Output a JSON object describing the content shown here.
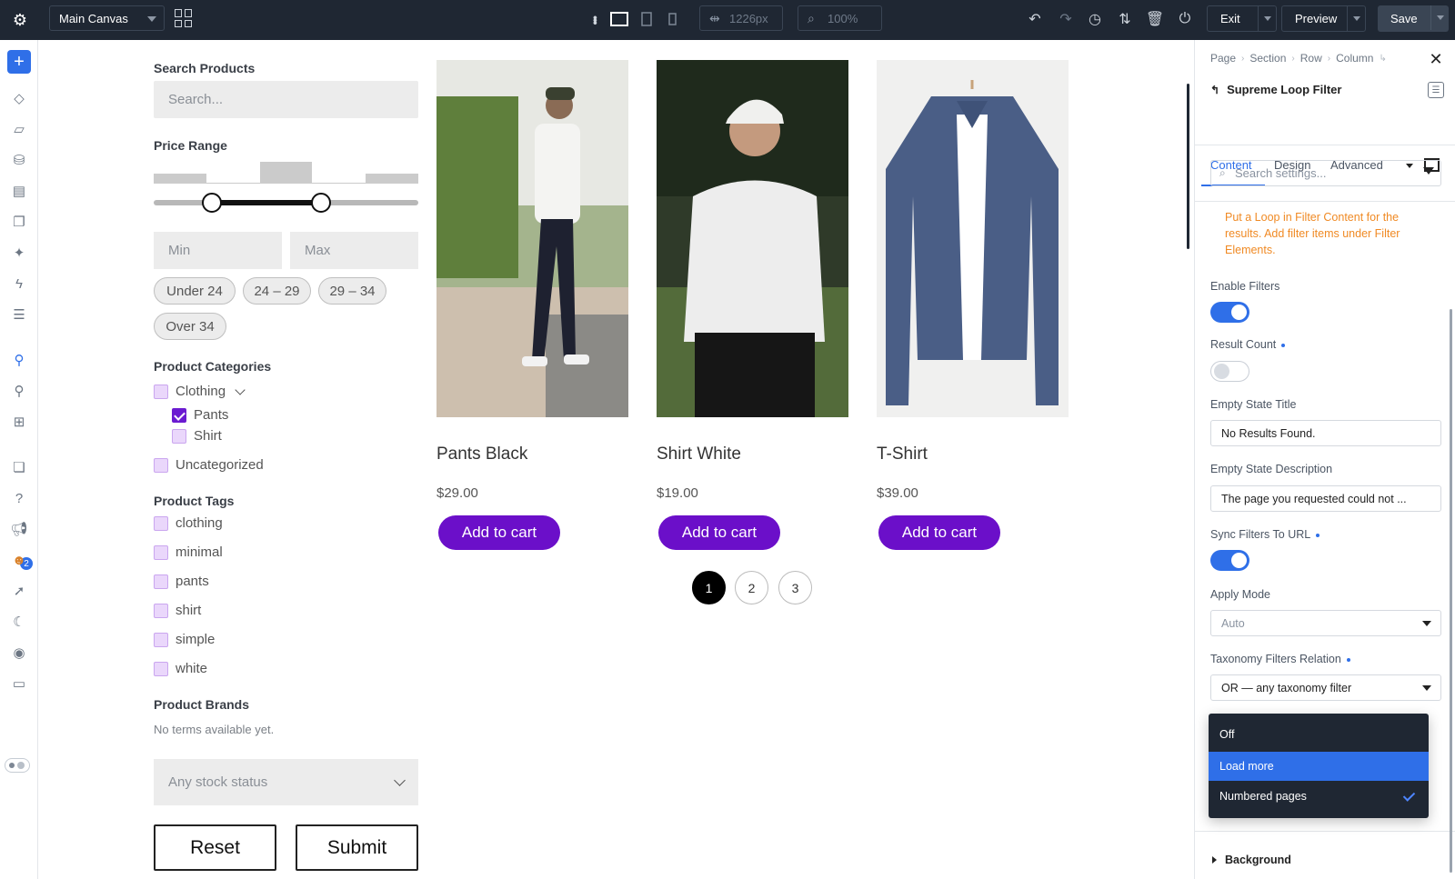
{
  "topbar": {
    "canvas_select": "Main Canvas",
    "width_value": "1226px",
    "zoom_value": "100%",
    "exit_label": "Exit",
    "preview_label": "Preview",
    "save_label": "Save"
  },
  "leftbar": {
    "add_icon": "+",
    "notification_count": "2"
  },
  "filters": {
    "search_heading": "Search Products",
    "search_placeholder": "Search...",
    "price_heading": "Price Range",
    "min_placeholder": "Min",
    "max_placeholder": "Max",
    "price_chips": [
      "Under 24",
      "24 – 29",
      "29 – 34",
      "Over 34"
    ],
    "categories_heading": "Product Categories",
    "categories": [
      {
        "label": "Clothing",
        "checked": false
      },
      {
        "label": "Pants",
        "checked": true
      },
      {
        "label": "Shirt",
        "checked": false
      },
      {
        "label": "Uncategorized",
        "checked": false
      }
    ],
    "tags_heading": "Product Tags",
    "tags": [
      "clothing",
      "minimal",
      "pants",
      "shirt",
      "simple",
      "white"
    ],
    "brands_heading": "Product Brands",
    "brands_empty": "No terms available yet.",
    "stock_placeholder": "Any stock status",
    "reset_label": "Reset",
    "submit_label": "Submit",
    "price_slider": {
      "min_fraction": 0.22,
      "max_fraction": 0.63
    }
  },
  "products": [
    {
      "name": "Pants Black",
      "price": "$29.00",
      "cart_label": "Add to cart"
    },
    {
      "name": "Shirt White",
      "price": "$19.00",
      "cart_label": "Add to cart"
    },
    {
      "name": "T-Shirt",
      "price": "$39.00",
      "cart_label": "Add to cart"
    }
  ],
  "pagination": [
    "1",
    "2",
    "3"
  ],
  "panel": {
    "breadcrumbs": [
      "Page",
      "Section",
      "Row",
      "Column"
    ],
    "module_title": "Supreme Loop Filter",
    "tabs": [
      "Content",
      "Design",
      "Advanced"
    ],
    "search_placeholder": "Search settings...",
    "notice": "Put a Loop in Filter Content for the results. Add filter items under Filter Elements.",
    "enable_filters_label": "Enable Filters",
    "result_count_label": "Result Count",
    "empty_title_label": "Empty State Title",
    "empty_title_value": "No Results Found.",
    "empty_desc_label": "Empty State Description",
    "empty_desc_value": "The page you requested could not ...",
    "sync_label": "Sync Filters To URL",
    "apply_mode_label": "Apply Mode",
    "apply_mode_value": "Auto",
    "taxonomy_label": "Taxonomy Filters Relation",
    "taxonomy_value": "OR — any taxonomy filter",
    "dropdown_options": [
      "Off",
      "Load more",
      "Numbered pages"
    ],
    "background_label": "Background"
  },
  "colors": {
    "accent": "#2f6fe8",
    "cart_button": "#6b0fc9",
    "notice_text": "#f08a24",
    "topbar_bg": "#1f2733"
  }
}
